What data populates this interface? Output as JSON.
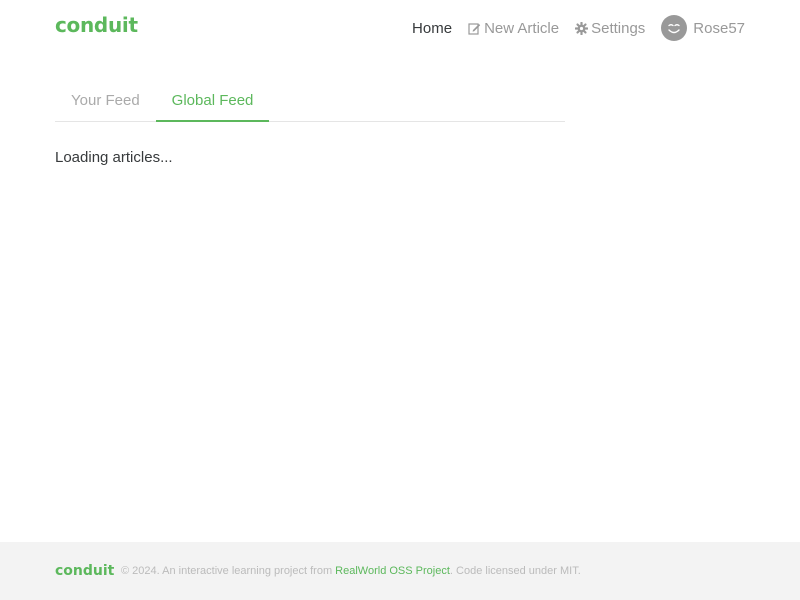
{
  "nav": {
    "brand": "conduit",
    "home": "Home",
    "new_article": "New Article",
    "settings": "Settings",
    "username": "Rose57",
    "icons": {
      "new_article": "edit-icon",
      "settings": "gear-icon",
      "avatar": "smiley-avatar"
    }
  },
  "feed": {
    "tabs": [
      "Your Feed",
      "Global Feed"
    ],
    "active_tab": "Global Feed",
    "loading_text": "Loading articles..."
  },
  "footer": {
    "logo": "conduit",
    "text_before": "© 2024. An interactive learning project from",
    "link_text": "RealWorld OSS Project",
    "text_after": ". Code licensed under MIT."
  },
  "colors": {
    "accent": "#5cb85c",
    "text": "#373a3c",
    "muted": "#999999",
    "footer_bg": "#f3f3f3"
  }
}
